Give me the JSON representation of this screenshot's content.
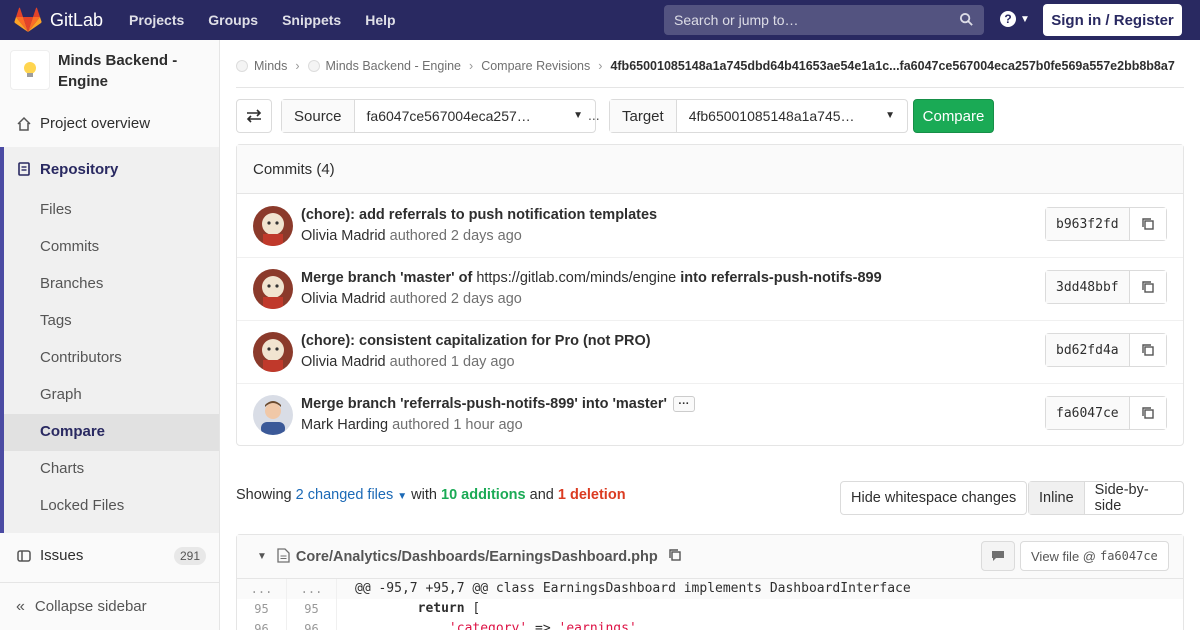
{
  "topnav": {
    "logo_text": "GitLab",
    "links": [
      "Projects",
      "Groups",
      "Snippets",
      "Help"
    ],
    "search_placeholder": "Search or jump to…",
    "help_icon": "?",
    "signin_label": "Sign in / Register",
    "bg_color": "#292961"
  },
  "sidebar": {
    "project_name": "Minds Backend - Engine",
    "overview": "Project overview",
    "repository": "Repository",
    "repo_items": [
      "Files",
      "Commits",
      "Branches",
      "Tags",
      "Contributors",
      "Graph",
      "Compare",
      "Charts",
      "Locked Files"
    ],
    "active_item": "Compare",
    "issues": "Issues",
    "issues_count": "291",
    "collapse": "Collapse sidebar"
  },
  "breadcrumb": {
    "items": [
      "Minds",
      "Minds Backend - Engine",
      "Compare Revisions"
    ],
    "current": "4fb65001085148a1a745dbd64b41653ae54e1a1c...fa6047ce567004eca257b0fe569a557e2bb8b8a7"
  },
  "compare": {
    "source_label": "Source",
    "source_value": "fa6047ce567004eca257…",
    "separator": "...",
    "target_label": "Target",
    "target_value": "4fb65001085148a1a745…",
    "button_label": "Compare"
  },
  "commits": {
    "header": "Commits (4)",
    "items": [
      {
        "title": "(chore): add referrals to push notification templates",
        "author": "Olivia Madrid",
        "authored": "authored",
        "time": "2 days ago",
        "sha": "b963f2fd"
      },
      {
        "title_pre": "Merge branch 'master' of",
        "title_link": "https://gitlab.com/minds/engine",
        "title_post": "into referrals-push-notifs-899",
        "author": "Olivia Madrid",
        "authored": "authored",
        "time": "2 days ago",
        "sha": "3dd48bbf"
      },
      {
        "title": "(chore): consistent capitalization for Pro (not PRO)",
        "author": "Olivia Madrid",
        "authored": "authored",
        "time": "1 day ago",
        "sha": "bd62fd4a"
      },
      {
        "title": "Merge branch 'referrals-push-notifs-899' into 'master'",
        "ellipsis": "···",
        "author": "Mark Harding",
        "authored": "authored",
        "time": "1 hour ago",
        "sha": "fa6047ce"
      }
    ]
  },
  "summary": {
    "showing": "Showing",
    "files": "2 changed files",
    "with": "with",
    "additions": "10 additions",
    "and": "and",
    "deletions": "1 deletion",
    "whitespace_btn": "Hide whitespace changes",
    "inline_btn": "Inline",
    "side_btn": "Side-by-side"
  },
  "diff": {
    "file_path": "Core/Analytics/Dashboards/EarningsDashboard.php",
    "view_file": "View file @",
    "view_sha": "fa6047ce",
    "lines": [
      {
        "old": "...",
        "new": "...",
        "code": "@@ -95,7 +95,7 @@ class EarningsDashboard implements DashboardInterface"
      },
      {
        "old": "95",
        "new": "95",
        "kw": "return",
        "code": " ["
      },
      {
        "old": "96",
        "new": "96",
        "str1": "'category'",
        "op": " => ",
        "str2": "'earnings'"
      }
    ]
  }
}
